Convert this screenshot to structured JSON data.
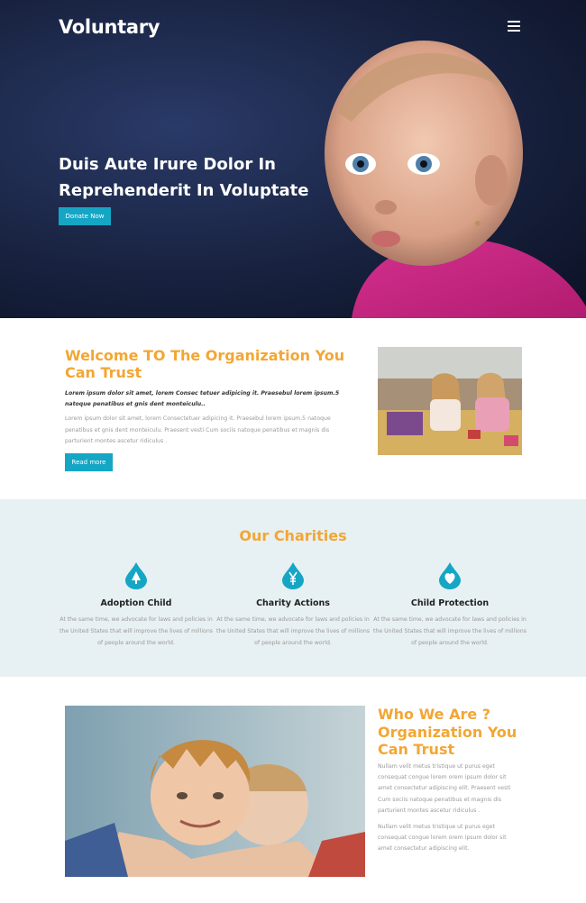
{
  "nav": {
    "brand": "Voluntary"
  },
  "hero": {
    "title": "Duis Aute Irure Dolor In Reprehenderit In Voluptate",
    "cta": "Donate Now"
  },
  "welcome": {
    "title": "Welcome TO The Organization You Can Trust",
    "lead": "Lorem ipsum dolor sit amet, lorem Consec tetuer adipicing it. Praesebul lorem ipsum.5 natoque penatibus et gnis dent monteiculu..",
    "body": "Lorem ipsum dolor sit amet, lorem Consectetuer adipicing it. Praesebul lorem ipsum.5 natoque penatibus et gnis dent monteiculu. Praesent vesti Cum sociis natoque penatibus et magnis dis parturient montes ascetur ridiculus .",
    "button": "Read more"
  },
  "charities": {
    "title": "Our Charities",
    "items": [
      {
        "icon": "tree-drop-icon",
        "title": "Adoption Child",
        "text": "At the same time, we advocate for laws and policies in the United States that will improve the lives of millions of people around the world."
      },
      {
        "icon": "yen-drop-icon",
        "title": "Charity Actions",
        "text": "At the same time, we advocate for laws and policies in the United States that will improve the lives of millions of people around the world."
      },
      {
        "icon": "heart-drop-icon",
        "title": "Child Protection",
        "text": "At the same time, we advocate for laws and policies in the United States that will improve the lives of millions of people around the world."
      }
    ]
  },
  "who": {
    "title": "Who We Are ? Organization You Can Trust",
    "p1": "Nullam velit metus tristique ut purus eget consequat congue lorem orem ipsum dolor sit amet consectetur adipiscing elit. Praesent vesti Cum sociis natoque penatibus et magnis dis parturient montes ascetur ridiculus .",
    "p2": "Nullam velit metus tristique ut purus eget consequat congue lorem orem ipsum dolor sit amet consectetur adipiscing elit."
  },
  "colors": {
    "accent_orange": "#f3a634",
    "accent_teal": "#16a6c5",
    "section_bg": "#e7f0f2"
  }
}
